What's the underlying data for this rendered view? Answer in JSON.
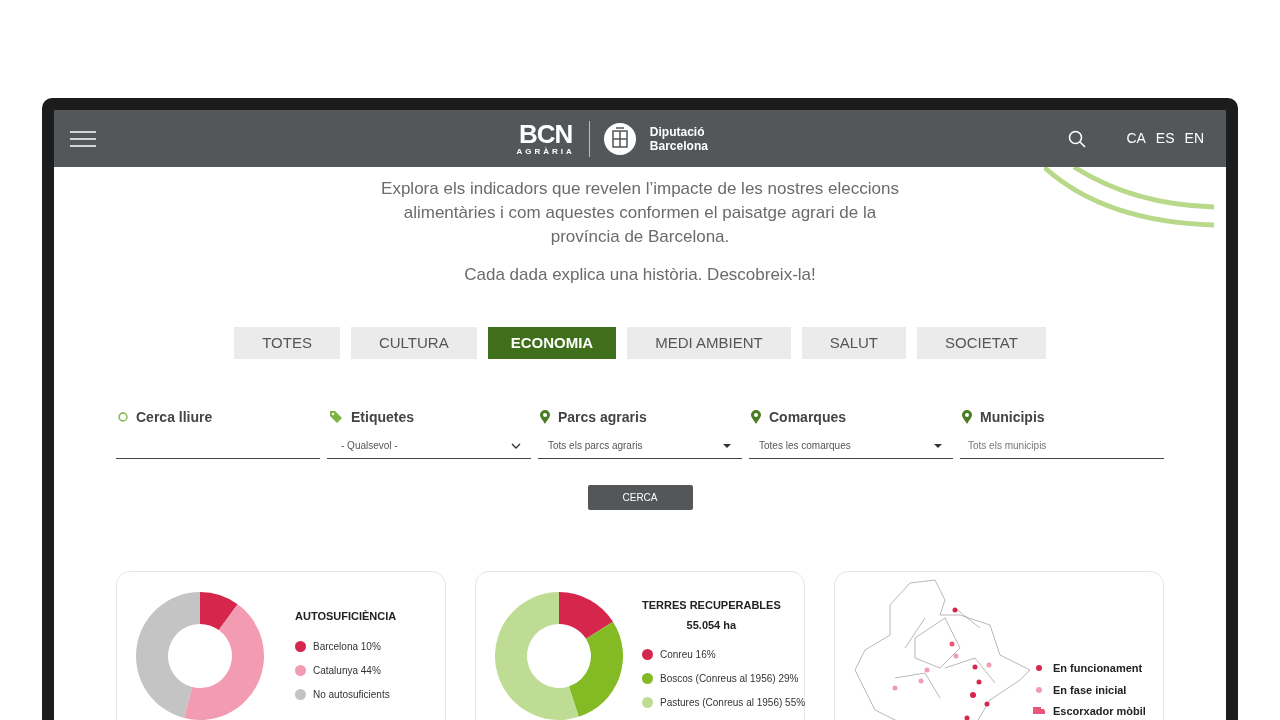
{
  "header": {
    "logo": {
      "mark": "BCN",
      "subtitle": "AGRÀRIA"
    },
    "partner": {
      "line1": "Diputació",
      "line2": "Barcelona"
    },
    "languages": [
      "CA",
      "ES",
      "EN"
    ]
  },
  "intro": {
    "text": "Explora els indicadors que revelen l’impacte de les nostres eleccions alimentàries i com aquestes conformen el paisatge agrari de la província de Barcelona.",
    "tagline": "Cada dada explica una història. Descobreix-la!"
  },
  "tabs": [
    {
      "label": "TOTES",
      "selected": false
    },
    {
      "label": "CULTURA",
      "selected": false
    },
    {
      "label": "ECONOMIA",
      "selected": true
    },
    {
      "label": "MEDI AMBIENT",
      "selected": false
    },
    {
      "label": "SALUT",
      "selected": false
    },
    {
      "label": "SOCIETAT",
      "selected": false
    }
  ],
  "filters": [
    {
      "kind": "search",
      "label": "Cerca lliure"
    },
    {
      "kind": "tags",
      "label": "Etiquetes",
      "value": "- Qualsevol -"
    },
    {
      "kind": "select",
      "label": "Parcs agraris",
      "value": "Tots els parcs agraris"
    },
    {
      "kind": "select",
      "label": "Comarques",
      "value": "Totes les comarques"
    },
    {
      "kind": "text",
      "label": "Municipis",
      "placeholder": "Tots els municipis"
    }
  ],
  "search_button": "CERCA",
  "cards": [
    {
      "kind": "donut",
      "title": "AUTOSUFICIÈNCIA",
      "legend": [
        {
          "color": "#d6264c"
        },
        {
          "color": "#f29bb2"
        },
        {
          "color": "#c4c4c4"
        }
      ],
      "chart_data": {
        "type": "donut",
        "categories": [
          "Barcelona 10%",
          "Catalunya 44%",
          "No autosuficients"
        ],
        "values": [
          10,
          44,
          46
        ]
      }
    },
    {
      "kind": "donut",
      "title": "TERRES RECUPERABLES",
      "subtitle": "55.054 ha",
      "legend": [
        {
          "color": "#d6264c"
        },
        {
          "color": "#84bb25"
        },
        {
          "color": "#bfdc95"
        }
      ],
      "chart_data": {
        "type": "donut",
        "categories": [
          "Conreu 16%",
          "Boscos (Conreus al 1956) 29%",
          "Pastures (Conreus al 1956) 55%"
        ],
        "values": [
          16,
          29,
          55
        ]
      }
    },
    {
      "kind": "map",
      "legend": [
        {
          "label": "En funcionament",
          "color": "#d6264c",
          "kind": "dot"
        },
        {
          "label": "En fase inicial",
          "color": "#f29bb2",
          "kind": "dot"
        },
        {
          "label": "Escorxador mòbil",
          "color": "#e8577a",
          "kind": "truck"
        }
      ]
    }
  ]
}
